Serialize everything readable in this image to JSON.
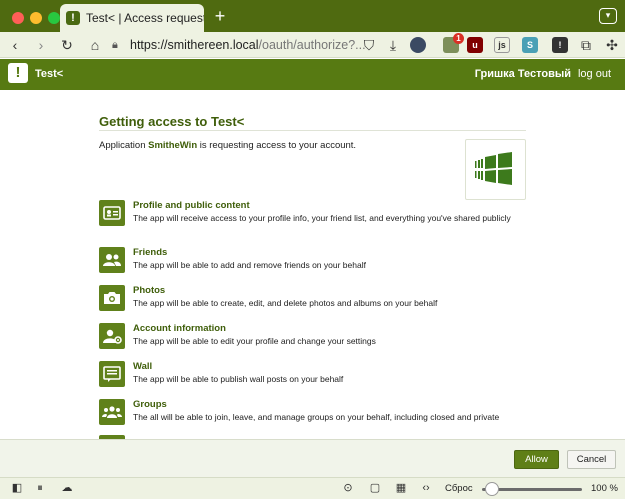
{
  "browser": {
    "tab_title": "Test< | Access request",
    "url_host": "https://smithereen.local",
    "url_path": "/oauth/authorize?...",
    "extension_badge": "1"
  },
  "site": {
    "name": "Test<",
    "user_name": "Гришка Тестовый",
    "logout_label": "log out"
  },
  "page": {
    "heading": "Getting access to Test<",
    "intro_prefix": "Application ",
    "app_name": "SmitheWin",
    "intro_suffix": " is requesting access to your account."
  },
  "permissions": [
    {
      "title": "Profile and public content",
      "description": "The app will receive access to your profile info, your friend list, and everything you've shared publicly",
      "icon": "id-card-icon"
    },
    {
      "title": "Friends",
      "description": "The app will be able to add and remove friends on your behalf",
      "icon": "friends-icon"
    },
    {
      "title": "Photos",
      "description": "The app will be able to create, edit, and delete photos and albums on your behalf",
      "icon": "camera-icon"
    },
    {
      "title": "Account information",
      "description": "The app will be able to edit your profile and change your settings",
      "icon": "user-settings-icon"
    },
    {
      "title": "Wall",
      "description": "The app will be able to publish wall posts on your behalf",
      "icon": "wall-icon"
    },
    {
      "title": "Groups",
      "description": "The all will be able to join, leave, and manage groups on your behalf, including closed and private",
      "icon": "groups-icon"
    }
  ],
  "actions": {
    "allow_label": "Allow",
    "cancel_label": "Cancel"
  },
  "statusbar": {
    "reset_label": "Сброс",
    "zoom_value": "100 %",
    "zoom_fraction": 0.1
  },
  "colors": {
    "brand": "#577a12",
    "brand_dark": "#3f5e0a",
    "tabbar": "#4f6a10"
  }
}
